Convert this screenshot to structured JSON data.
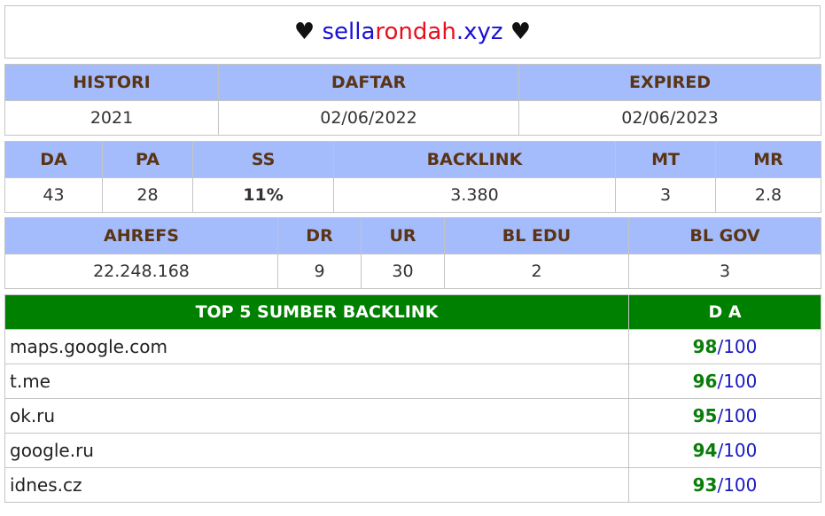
{
  "title": {
    "left_heart": "♥",
    "domain_part1": "sella",
    "domain_part2": "rondah",
    "domain_part3": ".xyz",
    "right_heart": "♥"
  },
  "dates": {
    "headers": [
      "HISTORI",
      "DAFTAR",
      "EXPIRED"
    ],
    "values": [
      "2021",
      "02/06/2022",
      "02/06/2023"
    ]
  },
  "metrics": {
    "headers": [
      "DA",
      "PA",
      "SS",
      "BACKLINK",
      "MT",
      "MR"
    ],
    "values": [
      "43",
      "28",
      "11%",
      "3.380",
      "3",
      "2.8"
    ]
  },
  "ahrefs": {
    "headers": [
      "AHREFS",
      "DR",
      "UR",
      "BL EDU",
      "BL GOV"
    ],
    "values": [
      "22.248.168",
      "9",
      "30",
      "2",
      "3"
    ]
  },
  "top_backlinks": {
    "header_source": "TOP 5 SUMBER BACKLINK",
    "header_da": "D A",
    "max": "100",
    "slash": "/",
    "rows": [
      {
        "site": "maps.google.com",
        "score": "98"
      },
      {
        "site": "t.me",
        "score": "96"
      },
      {
        "site": "ok.ru",
        "score": "95"
      },
      {
        "site": "google.ru",
        "score": "94"
      },
      {
        "site": "idnes.cz",
        "score": "93"
      }
    ]
  },
  "colors": {
    "header_bg": "#a4bcfb",
    "header_text": "#5a3414",
    "top_header_bg": "#008000",
    "score_green": "#0a7d0a",
    "max_blue": "#1a1ac0",
    "ss_cyan": "#23c6d2",
    "domain_blue": "#1a11d6",
    "domain_red": "#e80e1e"
  }
}
